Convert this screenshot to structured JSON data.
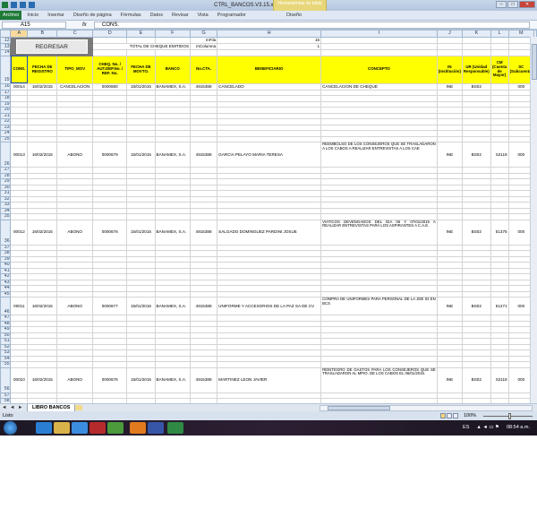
{
  "window": {
    "title": "CTRL_BANCOS.V3.15.xlsm - Microsoft Excel",
    "contextual_tab": "Herramientas de tabla",
    "controls": [
      "–",
      "□",
      "✕"
    ]
  },
  "ribbon": {
    "file_tab": "Archivo",
    "tabs": [
      "Inicio",
      "Insertar",
      "Diseño de página",
      "Fórmulas",
      "Datos",
      "Revisar",
      "Vista",
      "Programador"
    ],
    "contextual": "Diseño"
  },
  "formula_bar": {
    "name_box": "A15",
    "fx": "fx",
    "value": "CONS."
  },
  "columns": [
    "A",
    "B",
    "C",
    "D",
    "E",
    "F",
    "G",
    "H",
    "I",
    "J",
    "K",
    "L",
    "M"
  ],
  "top_area": {
    "regresar_label": "REGRESAR",
    "total_label": "TOTAL DE CHEQUE EMITIDOS",
    "mfila_label": "mFila",
    "mfila_value": "15",
    "mcolumna_label": "mColumna",
    "mcolumna_value": "1"
  },
  "headers": [
    "CONS.",
    "FECHA DE REGISTRO",
    "TIPO_MOV",
    "CHEQ. No. / AUT.DEP.No. / REF. No.",
    "FECHA DE MOVTO.",
    "BANCO",
    "No.CTA.",
    "BENEFICIARIO",
    "CONCEPTO",
    "IN (Institución)",
    "UR (Unidad Responsable)",
    "CM (Cuenta de Mayor)",
    "SC (Subcuenta)"
  ],
  "rows": [
    {
      "n": 16,
      "cells": [
        "00014",
        "16/02/2015",
        "CANCELACION",
        "0000680",
        "15/01/2015",
        "BANAMEX, S.A.",
        "4915388",
        "CANCELADO",
        "CANCELACION DE CHEQUE",
        "INE",
        "BS02",
        "",
        "000"
      ]
    },
    {
      "n": 26,
      "cells": [
        "00013",
        "16/02/2015",
        "ABONO",
        "0000679",
        "15/01/2015",
        "BANAMEX, S.A.",
        "4915388",
        "GARCIA PELAYO MARIA TERESA",
        "REEMBOLSO DE LOS CONSEJEROS QUE SE TRASLADARON A LOS CABOS A REALIZAR ENTREVISTAS A LOS CAE",
        "INE",
        "BS02",
        "52119",
        "000"
      ]
    },
    {
      "n": 36,
      "cells": [
        "00012",
        "16/02/2015",
        "ABONO",
        "0000678",
        "15/01/2015",
        "BANAMEX, S.A.",
        "4915388",
        "SALGADO DOMINGUEZ PARDINI JOSUE",
        "VIATICOS DEVENGADOS DEL DIA 06 Y 07/01/2015 A REALIZAR ENTREVISTAS PARA LOS ASPIRANTES A C.A.E.",
        "INE",
        "BS02",
        "51375",
        "000"
      ]
    },
    {
      "n": 46,
      "cells": [
        "00011",
        "16/02/2015",
        "ABONO",
        "0000677",
        "15/01/2015",
        "BANAMEX, S.A.",
        "4915388",
        "UNIFORME Y ACCESORIOS DE LA PAZ SA DE CV",
        "COMPRA DE UNIFORMES PARA PERSONAL DE LA JDE 02 EN BCS",
        "INE",
        "BS02",
        "51271",
        "000"
      ]
    },
    {
      "n": 56,
      "cells": [
        "00010",
        "16/02/2015",
        "ABONO",
        "0000676",
        "15/01/2015",
        "BANAMEX, S.A.",
        "4915388",
        "MARTINEZ LEON JAVIER",
        "REINTEGRO DE GASTOS PARA LOS CONSEJEROS QUE SE TRASLADARON AL MPIO. DE LOS CABOS EL 06/01/2015.",
        "INE",
        "BS02",
        "52119",
        "000"
      ]
    }
  ],
  "sheet_tabs": {
    "nav": "◄ ◄ ► ►",
    "active": "LIBRO BANCOS"
  },
  "status": {
    "ready": "Listo",
    "zoom": "100%"
  },
  "taskbar": {
    "lang": "ES",
    "clock": "08:54 a.m."
  }
}
